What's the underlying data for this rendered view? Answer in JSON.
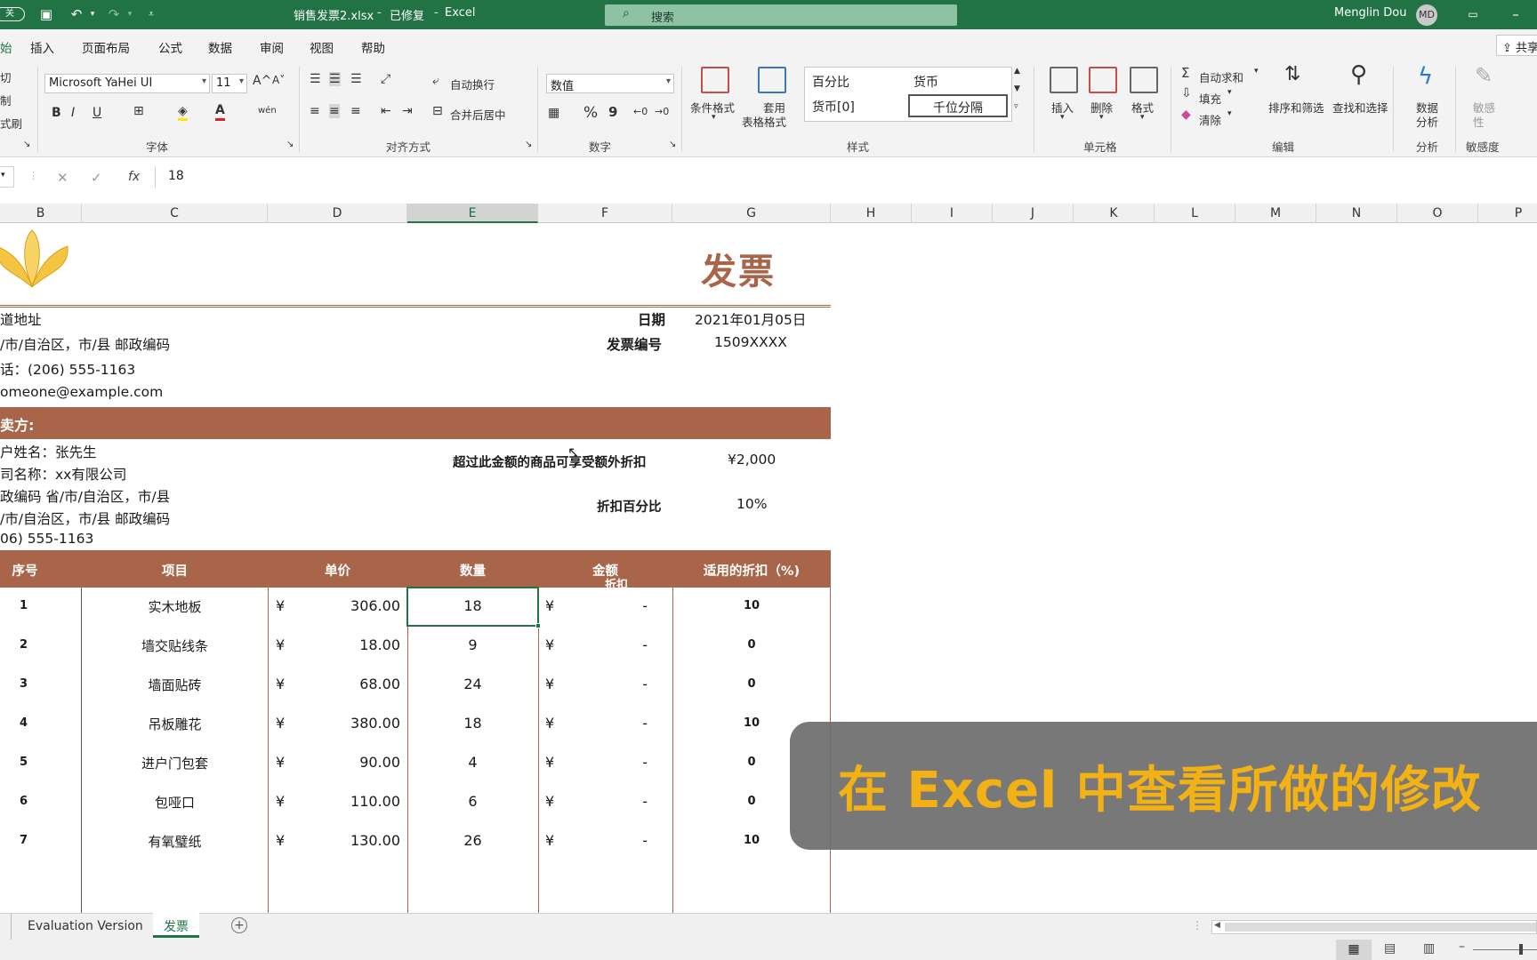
{
  "titlebar": {
    "filename": "销售发票2.xlsx",
    "state": "已修复",
    "app": "Excel",
    "autosave": "关",
    "search_label": "搜索",
    "user": "Menglin Dou",
    "user_initials": "MD"
  },
  "ribbon_tabs": [
    "始",
    "插入",
    "页面布局",
    "公式",
    "数据",
    "审阅",
    "视图",
    "帮助"
  ],
  "ribbon_share": "共享",
  "clipboard": {
    "cut": "切",
    "copy": "制",
    "painter": "式刷"
  },
  "font": {
    "name": "Microsoft YaHei UI",
    "size": "11",
    "group_label": "字体",
    "bold": "B",
    "italic": "I",
    "underline": "U",
    "grow": "A^",
    "shrink": "A˅",
    "font_color": "A",
    "phonetic": "wén"
  },
  "alignment": {
    "wrap": "自动换行",
    "merge": "合并后居中",
    "group_label": "对齐方式"
  },
  "number": {
    "format": "数值",
    "group_label": "数字",
    "percent": "%",
    "comma": "9"
  },
  "styles": {
    "conditional": "条件格式",
    "table_a": "套用",
    "table_b": "表格格式",
    "cells": [
      "百分比",
      "货币",
      "货币[0]",
      "千位分隔"
    ],
    "group_label": "样式"
  },
  "cells_group": {
    "insert": "插入",
    "delete": "删除",
    "format": "格式",
    "group_label": "单元格"
  },
  "editing": {
    "autosum": "自动求和",
    "fill": "填充",
    "clear": "清除",
    "sort": "排序和筛选",
    "find": "查找和选择",
    "group_label": "编辑"
  },
  "analysis": {
    "a": "数据",
    "b": "分析",
    "group_label": "分析"
  },
  "sensitivity": {
    "a": "敏感",
    "b": "性",
    "group_label": "敏感度"
  },
  "formula_bar": {
    "fx": "fx",
    "value": "18"
  },
  "columns": [
    "B",
    "C",
    "D",
    "E",
    "F",
    "G",
    "H",
    "I",
    "J",
    "K",
    "L",
    "M",
    "N",
    "O",
    "P"
  ],
  "invoice": {
    "title": "发票",
    "address": [
      "道地址",
      "/市/自治区，市/县 邮政编码",
      "话：(206) 555-1163",
      "omeone@example.com"
    ],
    "date_label": "日期",
    "date_value": "2021年01月05日",
    "number_label": "发票编号",
    "number_value": "1509XXXX",
    "buyer_label": "卖方:",
    "buyer": [
      "户姓名：张先生",
      "司名称：xx有限公司",
      "政编码 省/市/自治区，市/县",
      "/市/自治区，市/县 邮政编码",
      "06) 555-1163"
    ],
    "threshold_label": "超过此金额的商品可享受额外折扣",
    "threshold_value": "¥2,000",
    "discount_label": "折扣百分比",
    "discount_value": "10%",
    "headers": [
      "序号",
      "项目",
      "单价",
      "数量",
      "金额",
      "适用的折扣（%)"
    ],
    "header_overflow": "折扣",
    "currency": "¥",
    "rows": [
      {
        "no": "1",
        "item": "实木地板",
        "price": "306.00",
        "qty": "18",
        "amount": "-",
        "disc": "10"
      },
      {
        "no": "2",
        "item": "墙交贴线条",
        "price": "18.00",
        "qty": "9",
        "amount": "-",
        "disc": "0"
      },
      {
        "no": "3",
        "item": "墙面贴砖",
        "price": "68.00",
        "qty": "24",
        "amount": "-",
        "disc": "0"
      },
      {
        "no": "4",
        "item": "吊板雕花",
        "price": "380.00",
        "qty": "18",
        "amount": "-",
        "disc": "10"
      },
      {
        "no": "5",
        "item": "进户门包套",
        "price": "90.00",
        "qty": "4",
        "amount": "-",
        "disc": "0"
      },
      {
        "no": "6",
        "item": "包哑口",
        "price": "110.00",
        "qty": "6",
        "amount": "-",
        "disc": "0"
      },
      {
        "no": "7",
        "item": "有氧璧纸",
        "price": "130.00",
        "qty": "26",
        "amount": "-",
        "disc": "10"
      }
    ]
  },
  "sheet_tabs": [
    "Evaluation Version",
    "发票"
  ],
  "overlay_caption": "在 Excel 中查看所做的修改",
  "colors": {
    "excel_green": "#217346",
    "invoice_brown": "#a8654a",
    "caption_yellow": "#f2b114"
  }
}
